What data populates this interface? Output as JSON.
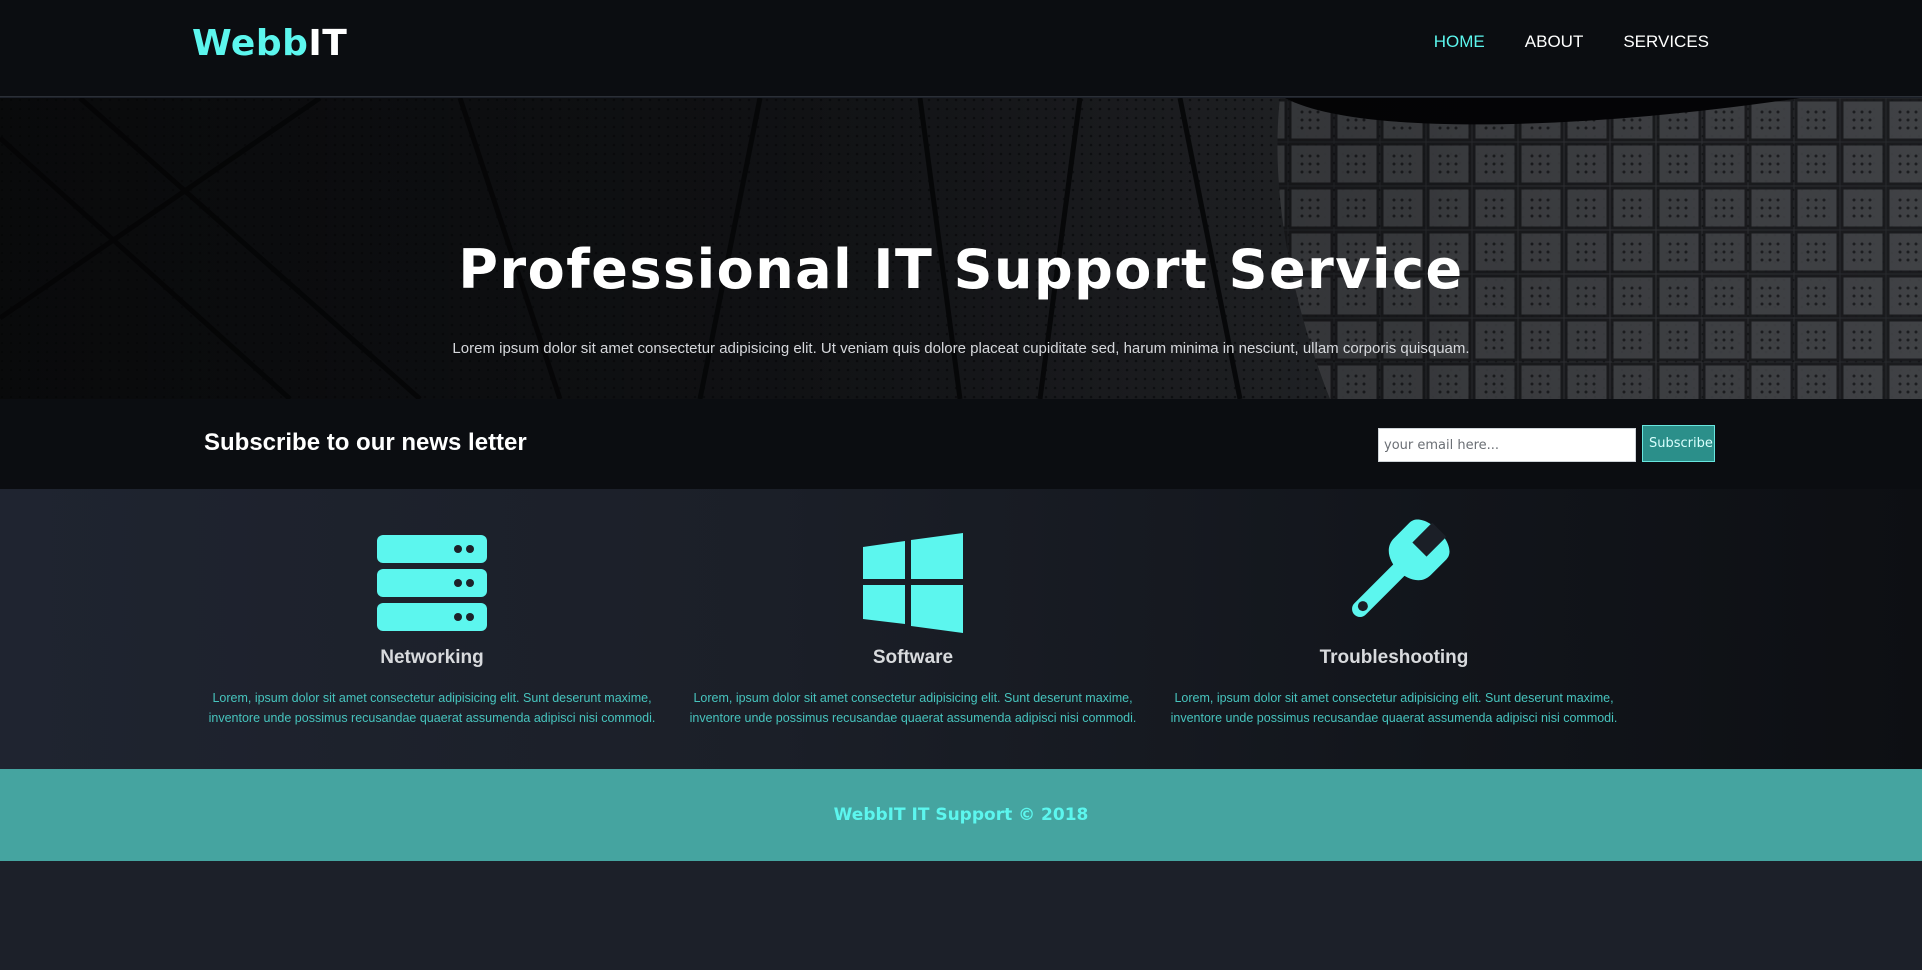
{
  "header": {
    "logo_part1": "Webb",
    "logo_part2": "IT",
    "nav": [
      {
        "label": "HOME",
        "active": true
      },
      {
        "label": "ABOUT",
        "active": false
      },
      {
        "label": "SERVICES",
        "active": false
      }
    ]
  },
  "hero": {
    "title": "Professional IT Support Service",
    "text": "Lorem ipsum dolor sit amet consectetur adipisicing elit. Ut veniam quis dolore placeat cupiditate sed, harum minima in nesciunt, ullam corporis quisquam."
  },
  "newsletter": {
    "heading": "Subscribe to our news letter",
    "email_placeholder": "your email here...",
    "button_label": "Subscribe"
  },
  "services": [
    {
      "icon": "server-icon",
      "title": "Networking",
      "line1": "Lorem, ipsum dolor sit amet consectetur adipisicing elit. Sunt deserunt maxime,",
      "line2": "inventore unde possimus recusandae quaerat assumenda adipisci nisi commodi."
    },
    {
      "icon": "windows-icon",
      "title": "Software",
      "line1": "Lorem, ipsum dolor sit amet consectetur adipisicing elit. Sunt deserunt maxime,",
      "line2": "inventore unde possimus recusandae quaerat assumenda adipisci nisi commodi."
    },
    {
      "icon": "wrench-icon",
      "title": "Troubleshooting",
      "line1": "Lorem, ipsum dolor sit amet consectetur adipisicing elit. Sunt deserunt maxime,",
      "line2": "inventore unde possimus recusandae quaerat assumenda adipisci nisi commodi."
    }
  ],
  "footer": {
    "text": "WebbIT IT Support © 2018"
  },
  "colors": {
    "accent": "#5cf6ee",
    "footer_bg": "#45a4a0",
    "dark_bg": "#0b0d11"
  }
}
